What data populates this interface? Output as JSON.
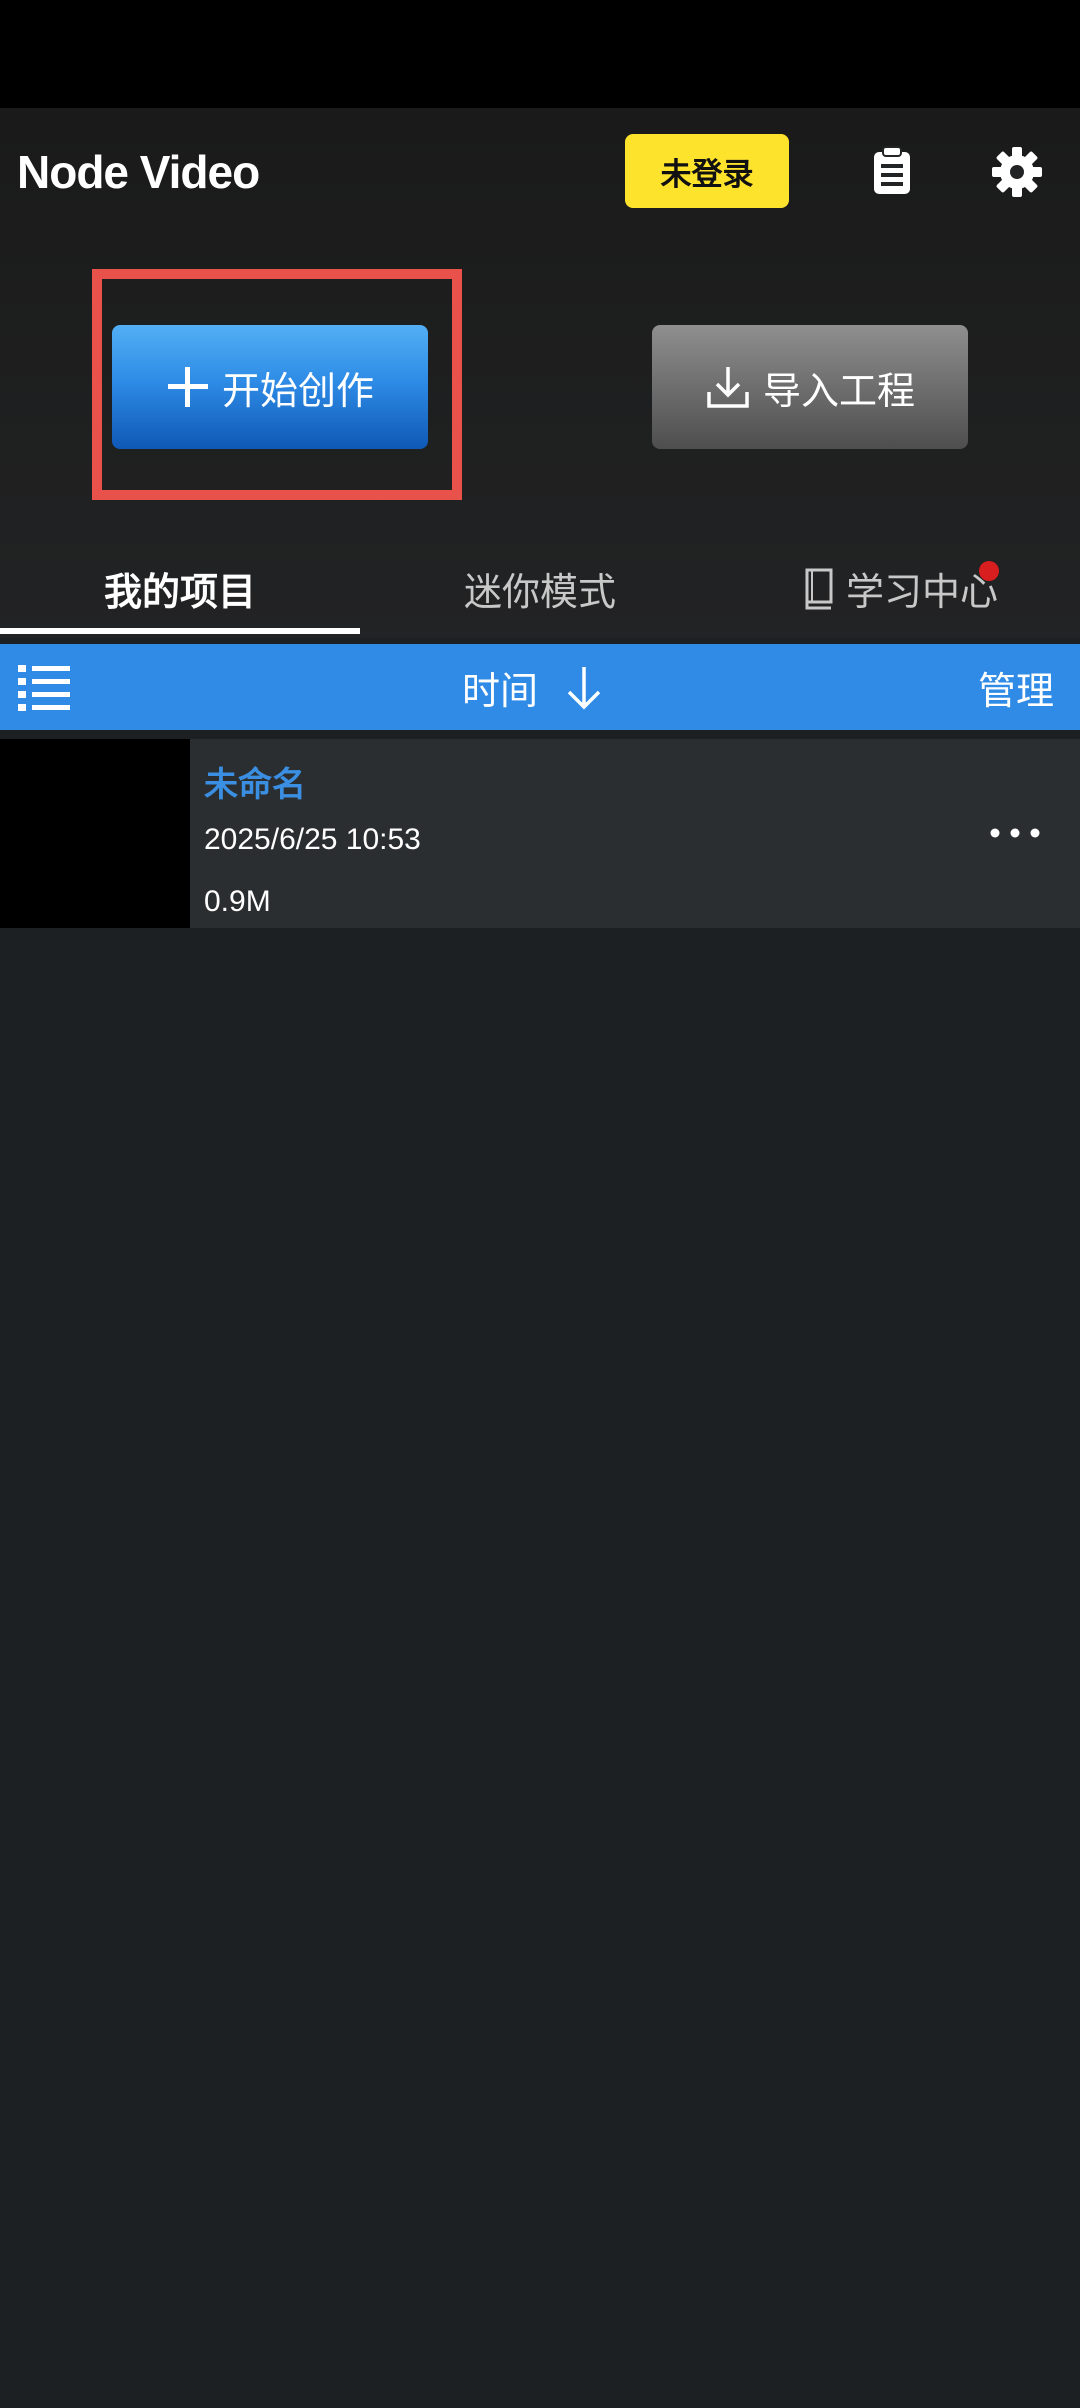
{
  "app": {
    "title": "Node Video",
    "login_badge": "未登录"
  },
  "icons": {
    "clipboard": "clipboard-icon",
    "settings": "gear-icon",
    "plus": "plus-icon",
    "download": "download-icon",
    "book": "book-icon",
    "list": "list-icon",
    "sort": "arrow-down-icon",
    "more": "more-horizontal-icon"
  },
  "actions": {
    "start_label": "开始创作",
    "import_label": "导入工程"
  },
  "tabs": [
    {
      "label": "我的项目",
      "selected": true
    },
    {
      "label": "迷你模式",
      "selected": false
    },
    {
      "label": "学习中心",
      "selected": false,
      "notification_dot": true
    }
  ],
  "toolbar": {
    "sort_label": "时间",
    "manage_label": "管理"
  },
  "projects": [
    {
      "name": "未命名",
      "date": "2025/6/25 10:53",
      "size": "0.9M"
    }
  ],
  "colors": {
    "accent": "#2f8be6",
    "badge": "#fde32b",
    "highlight": "#e8524a",
    "notification": "#d81e1e",
    "project_name": "#3b8fe3"
  }
}
